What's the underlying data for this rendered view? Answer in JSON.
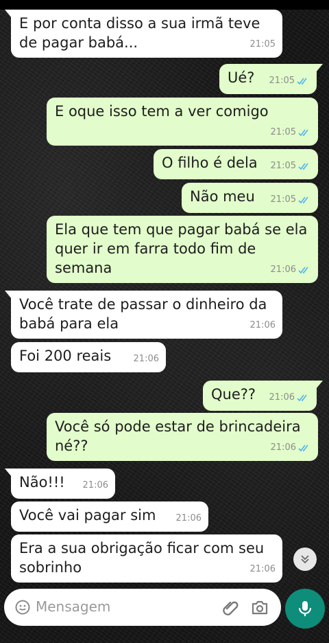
{
  "messages": [
    {
      "text": "E por conta disso a sua irmã teve de pagar babá...",
      "time": "21:05",
      "dir": "in"
    },
    {
      "text": "Ué?",
      "time": "21:05",
      "dir": "out"
    },
    {
      "text": "E oque isso tem a ver comigo",
      "time": "21:05",
      "dir": "out"
    },
    {
      "text": "O filho é dela",
      "time": "21:05",
      "dir": "out"
    },
    {
      "text": "Não meu",
      "time": "21:05",
      "dir": "out"
    },
    {
      "text": "Ela que tem que pagar babá se ela quer ir em farra todo fim de semana",
      "time": "21:06",
      "dir": "out"
    },
    {
      "text": "Você trate de passar o dinheiro da babá para ela",
      "time": "21:06",
      "dir": "in"
    },
    {
      "text": "Foi 200 reais",
      "time": "21:06",
      "dir": "in"
    },
    {
      "text": "Que??",
      "time": "21:06",
      "dir": "out"
    },
    {
      "text": "Você só pode estar de brincadeira né??",
      "time": "21:06",
      "dir": "out"
    },
    {
      "text": "Não!!!",
      "time": "21:06",
      "dir": "in"
    },
    {
      "text": "Você vai pagar sim",
      "time": "21:06",
      "dir": "in"
    },
    {
      "text": "Era a sua obrigação ficar com seu sobrinho",
      "time": "21:06",
      "dir": "in"
    }
  ],
  "composer": {
    "placeholder": "Mensagem",
    "icons": [
      "emoji-icon",
      "attach-icon",
      "camera-icon",
      "mic-icon"
    ]
  },
  "colors": {
    "incoming_bubble": "#ffffff",
    "outgoing_bubble": "#e2fccb",
    "read_ticks": "#4fb6ec",
    "mic_button": "#0e8d7b"
  }
}
